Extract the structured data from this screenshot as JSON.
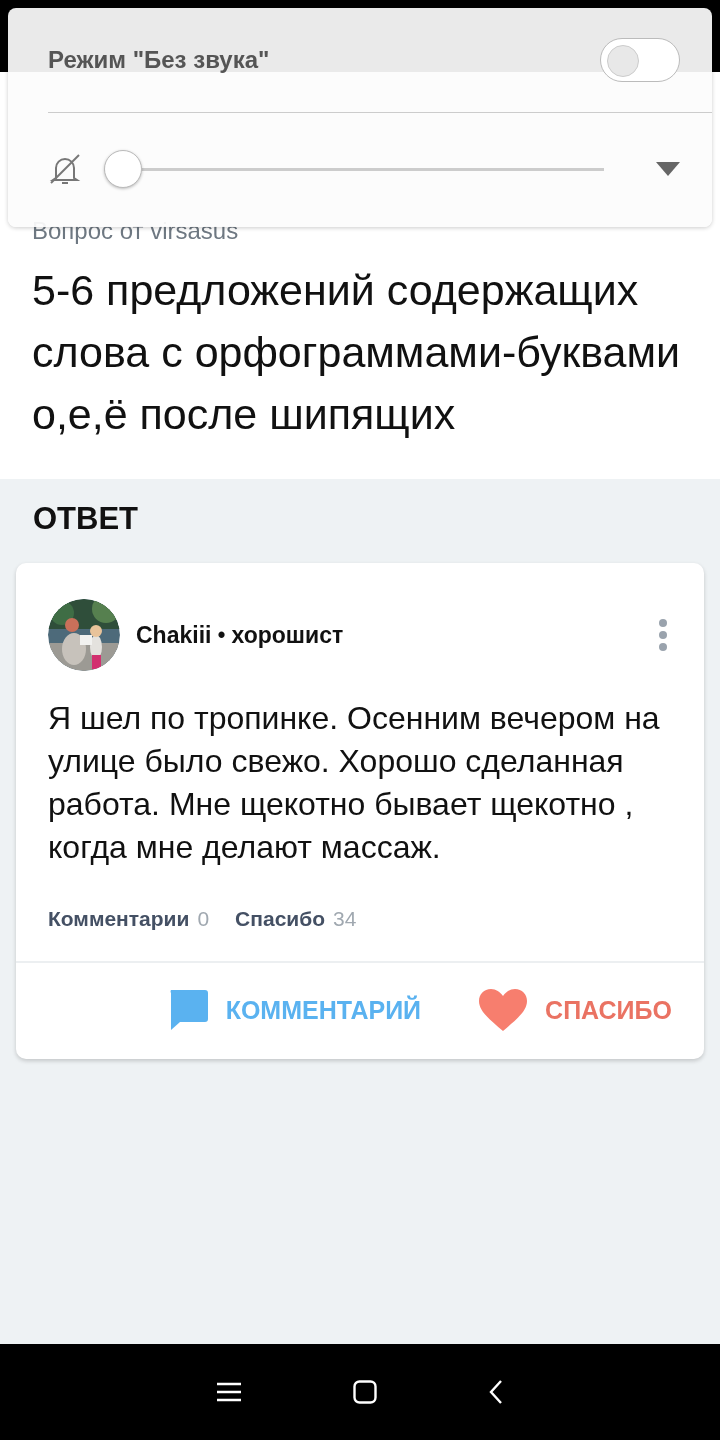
{
  "volume_panel": {
    "title": "Режим \"Без звука\"",
    "silent_mode": {
      "on": false
    },
    "slider": {
      "level": 0
    }
  },
  "question": {
    "author_line": "Вопрос от virsasus",
    "text": "5-6 предложений содержащих слова с орфограммами-буквами о,е,ё после шипящих"
  },
  "answer_heading": "ОТВЕТ",
  "answer": {
    "author": "Chakiii",
    "separator": "•",
    "rank": "хорошист",
    "text": "Я шел по тропинке. Осенним вечером на улице было свежо. Хорошо сделанная работа. Мне щекотно бывает щекотно , когда мне делают массаж.",
    "stats": [
      {
        "label": "Комментарии",
        "count": "0"
      },
      {
        "label": "Спасибо",
        "count": "34"
      }
    ],
    "actions": [
      {
        "kind": "comment",
        "label": "КОММЕНТАРИЙ"
      },
      {
        "kind": "thanks",
        "label": "СПАСИБО"
      }
    ]
  }
}
